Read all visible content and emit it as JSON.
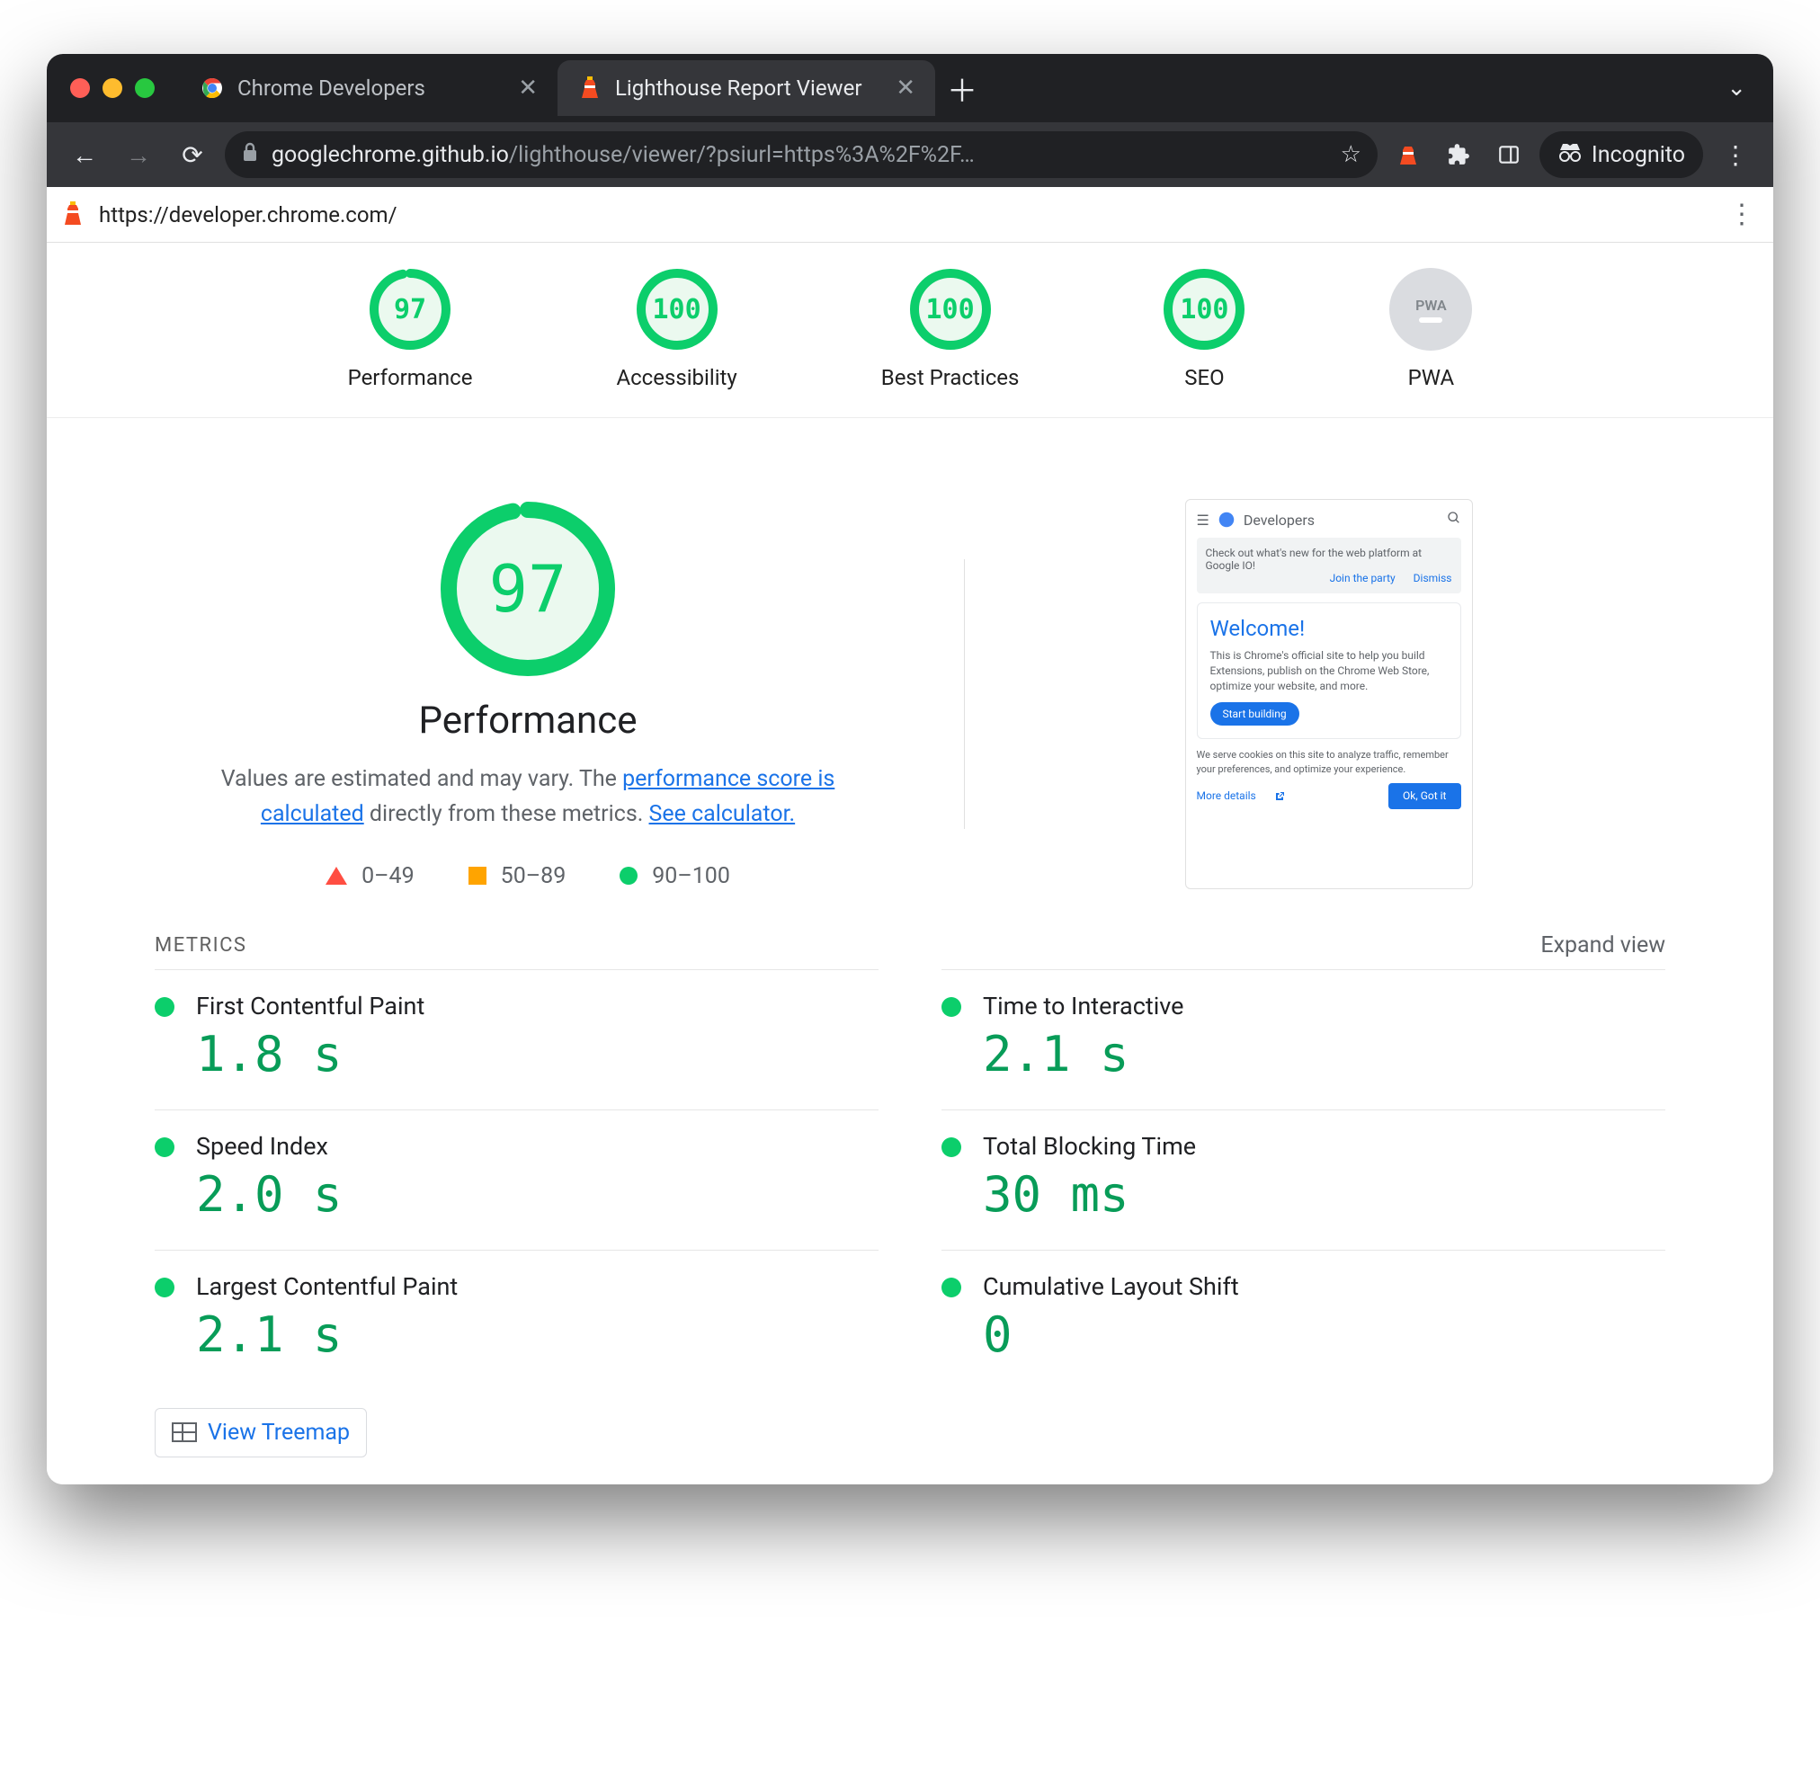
{
  "window": {
    "tabs": [
      {
        "title": "Chrome Developers",
        "active": false
      },
      {
        "title": "Lighthouse Report Viewer",
        "active": true
      }
    ],
    "incognito_label": "Incognito"
  },
  "omnibox": {
    "host": "googlechrome.github.io",
    "path": "/lighthouse/viewer/?psiurl=https%3A%2F%2F…"
  },
  "lighthouse_topbar": {
    "tested_url": "https://developer.chrome.com/"
  },
  "summary": {
    "items": [
      {
        "id": "performance",
        "label": "Performance",
        "score": 97
      },
      {
        "id": "accessibility",
        "label": "Accessibility",
        "score": 100
      },
      {
        "id": "best-practices",
        "label": "Best Practices",
        "score": 100
      },
      {
        "id": "seo",
        "label": "SEO",
        "score": 100
      }
    ],
    "pwa_label": "PWA"
  },
  "performance": {
    "big_score": 97,
    "heading": "Performance",
    "desc_prefix": "Values are estimated and may vary. The ",
    "desc_link1": "performance score is calculated",
    "desc_mid": " directly from these metrics. ",
    "desc_link2": "See calculator.",
    "legend": {
      "fail": "0–49",
      "avg": "50–89",
      "pass": "90–100"
    },
    "thumbnail": {
      "header": "Developers",
      "banner": "Check out what's new for the web platform at Google IO!",
      "banner_link1": "Join the party",
      "banner_link2": "Dismiss",
      "welcome_title": "Welcome!",
      "welcome_body": "This is Chrome's official site to help you build Extensions, publish on the Chrome Web Store, optimize your website, and more.",
      "welcome_cta": "Start building",
      "cookie_text": "We serve cookies on this site to analyze traffic, remember your preferences, and optimize your experience.",
      "cookie_more": "More details",
      "cookie_ok": "Ok, Got it"
    }
  },
  "metrics": {
    "heading": "METRICS",
    "expand": "Expand view",
    "left": [
      {
        "name": "First Contentful Paint",
        "value": "1.8 s"
      },
      {
        "name": "Speed Index",
        "value": "2.0 s"
      },
      {
        "name": "Largest Contentful Paint",
        "value": "2.1 s"
      }
    ],
    "right": [
      {
        "name": "Time to Interactive",
        "value": "2.1 s"
      },
      {
        "name": "Total Blocking Time",
        "value": "30 ms"
      },
      {
        "name": "Cumulative Layout Shift",
        "value": "0"
      }
    ],
    "treemap_label": "View Treemap"
  },
  "chart_data": {
    "type": "bar",
    "title": "Lighthouse category scores",
    "categories": [
      "Performance",
      "Accessibility",
      "Best Practices",
      "SEO"
    ],
    "values": [
      97,
      100,
      100,
      100
    ],
    "ylim": [
      0,
      100
    ],
    "pass_threshold": 90,
    "average_threshold": 50
  }
}
